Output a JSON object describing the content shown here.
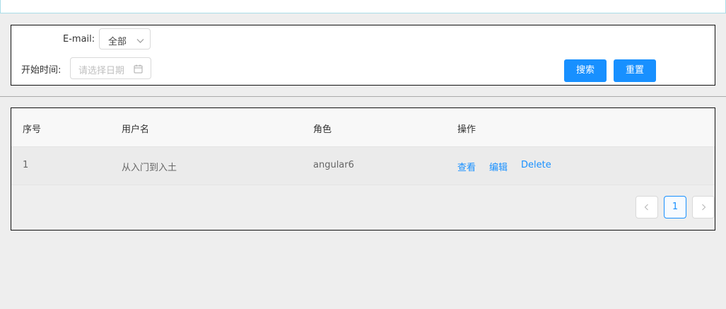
{
  "filter": {
    "email_label": "E-mail:",
    "email_value": "全部",
    "start_time_label": "开始时间:",
    "date_placeholder": "请选择日期",
    "search_label": "搜索",
    "reset_label": "重置"
  },
  "table": {
    "columns": [
      "序号",
      "用户名",
      "角色",
      "操作"
    ],
    "rows": [
      {
        "index": "1",
        "username": "从入门到入土",
        "role": "angular6",
        "actions": [
          "查看",
          "编辑",
          "Delete"
        ]
      }
    ]
  },
  "pagination": {
    "current_page": "1"
  },
  "colors": {
    "primary": "#1890ff",
    "page_background": "#eeeeee",
    "header_background": "#f8f8f8"
  },
  "icons": {
    "select_arrow": "chevron-down-icon",
    "date_picker": "calendar-icon",
    "prev_page": "chevron-left-icon",
    "next_page": "chevron-right-icon"
  }
}
